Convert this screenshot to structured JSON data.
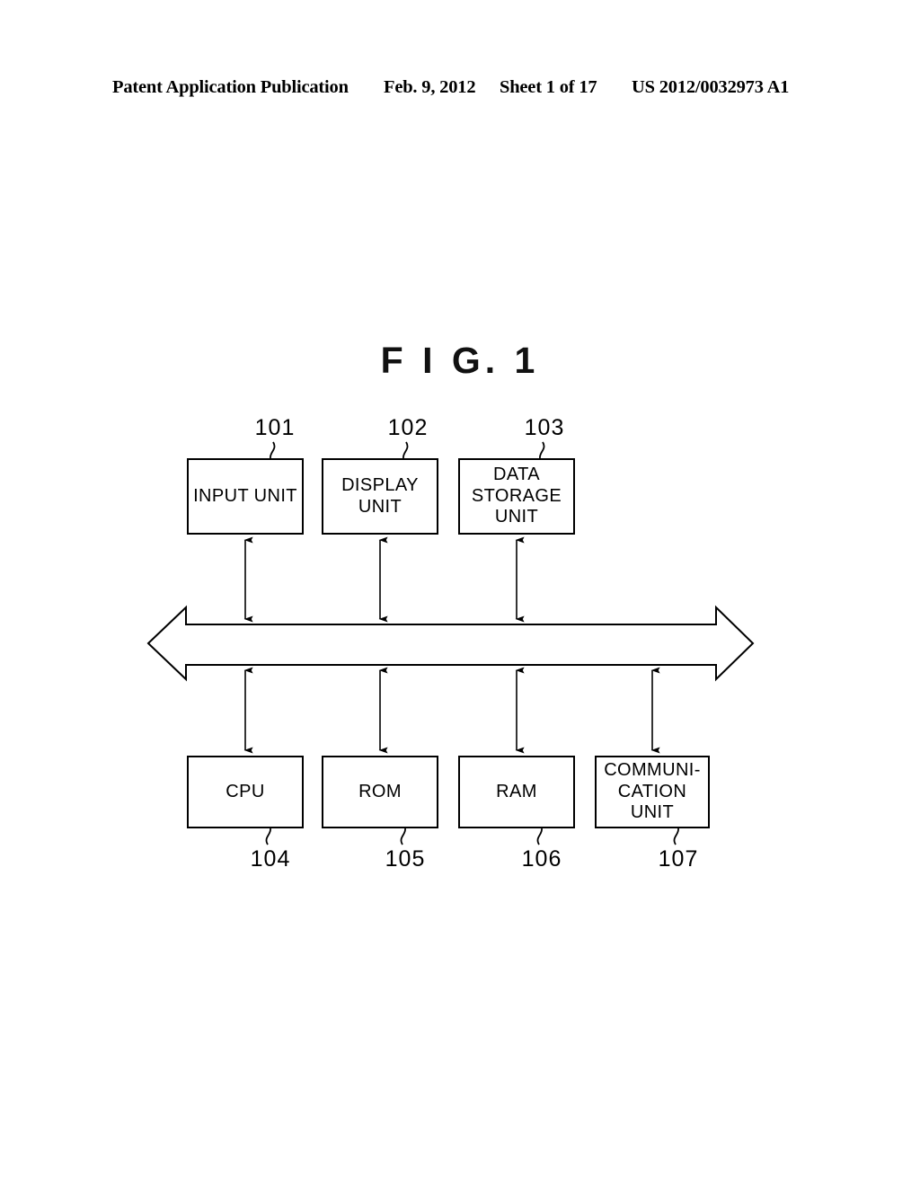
{
  "header": {
    "publication": "Patent Application Publication",
    "date": "Feb. 9, 2012",
    "sheet": "Sheet 1 of 17",
    "patent_number": "US 2012/0032973 A1"
  },
  "figure": {
    "title": "F I G. 1"
  },
  "diagram": {
    "type": "block-diagram",
    "bus": {
      "name": "system-bus",
      "style": "hollow double-headed horizontal arrow"
    },
    "top_row": [
      {
        "ref": "101",
        "label": "INPUT UNIT"
      },
      {
        "ref": "102",
        "label": "DISPLAY\nUNIT"
      },
      {
        "ref": "103",
        "label": "DATA\nSTORAGE\nUNIT"
      }
    ],
    "bottom_row": [
      {
        "ref": "104",
        "label": "CPU"
      },
      {
        "ref": "105",
        "label": "ROM"
      },
      {
        "ref": "106",
        "label": "RAM"
      },
      {
        "ref": "107",
        "label": "COMMUNI-\nCATION\nUNIT"
      }
    ]
  }
}
